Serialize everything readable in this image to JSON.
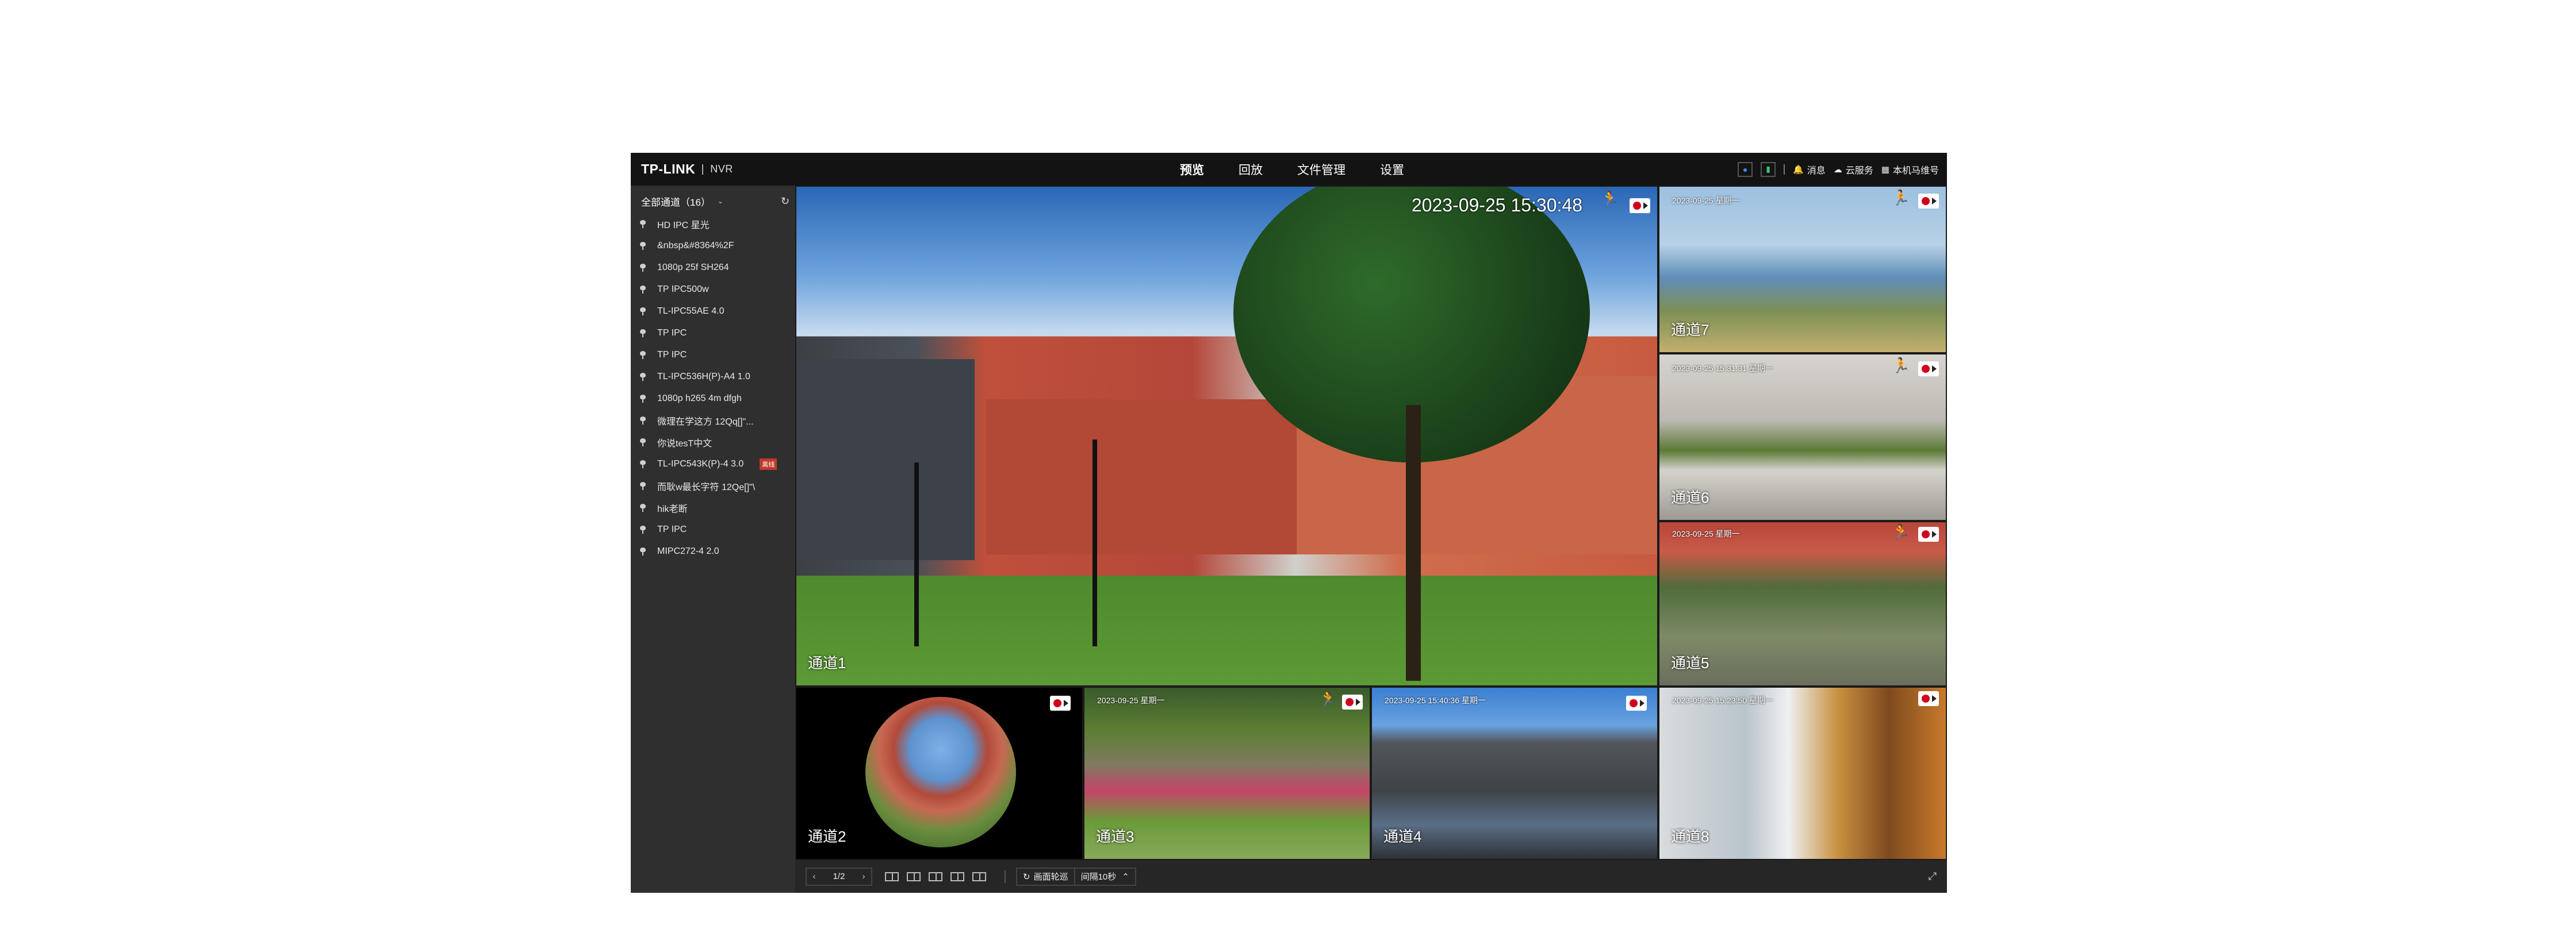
{
  "topbar": {
    "logo": "TP-LINK",
    "logo_sub": "NVR",
    "nav": [
      "预览",
      "回放",
      "文件管理",
      "设置"
    ],
    "tools": {
      "messages": "消息",
      "cloud": "云服务",
      "local": "本机马维号"
    }
  },
  "sidebar": {
    "header": "全部通道（16）",
    "channels": [
      {
        "name": "HD IPC 星光"
      },
      {
        "name": "&nbsp&#8364%2F"
      },
      {
        "name": "1080p 25f SH264"
      },
      {
        "name": "TP IPC500w"
      },
      {
        "name": "TL-IPC55AE 4.0"
      },
      {
        "name": "TP IPC"
      },
      {
        "name": "TP IPC"
      },
      {
        "name": "TL-IPC536H(P)-A4 1.0"
      },
      {
        "name": "1080p h265 4m dfgh"
      },
      {
        "name": "微理在学这方 12Qq[]\"..."
      },
      {
        "name": "你说tesT中文"
      },
      {
        "name": "TL-IPC543K(P)-4 3.0",
        "badge": "离线"
      },
      {
        "name": "而耿w最长字符 12Qe[]\"\\"
      },
      {
        "name": "hik老断"
      },
      {
        "name": "TP IPC"
      },
      {
        "name": "MIPC272-4 2.0"
      }
    ]
  },
  "tiles": {
    "t1": {
      "label": "通道1",
      "timestamp": "2023-09-25 15:30:48"
    },
    "t7": {
      "label": "通道7",
      "timestamp": "2023-09-25 星期一"
    },
    "t6": {
      "label": "通道6",
      "timestamp": "2023-09-25 15:31:31 星期一"
    },
    "t5": {
      "label": "通道5",
      "timestamp": "2023-09-25 星期一"
    },
    "t2": {
      "label": "通道2"
    },
    "t3": {
      "label": "通道3",
      "timestamp": "2023-09-25 星期一"
    },
    "t4": {
      "label": "通道4",
      "timestamp": "2023-09-25 15:40:36 星期一"
    },
    "t8": {
      "label": "通道8",
      "timestamp": "2023-09-25 15:23:50 星期一"
    }
  },
  "bottombar": {
    "page": "1/2",
    "cycle_label": "画面轮巡",
    "interval": "间隔10秒"
  },
  "colors": {
    "motion": "#2ecc40",
    "record": "#d0021b",
    "offline_badge": "#c0392b"
  }
}
